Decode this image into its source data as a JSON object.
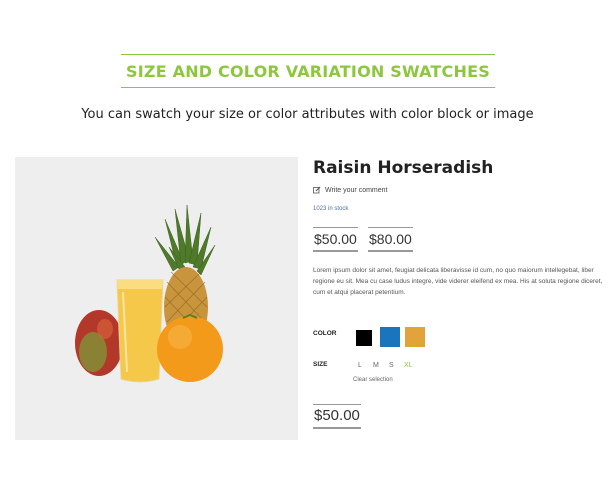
{
  "section": {
    "heading": "SIZE AND COLOR VARIATION SWATCHES",
    "subtitle": "You can swatch your size or color attributes with color block or image"
  },
  "product": {
    "image_alt": "fruit juice with pineapple, mango and orange",
    "title": "Raisin Horseradish",
    "review_link": "Write your comment",
    "stock": "1023 in stock",
    "prices": [
      "$50.00",
      "$80.00"
    ],
    "description": "Lorem ipsum dolor sit amet, feugiat delicata liberavisse id cum, no quo maiorum intellegebat, liber regione eu sit. Mea cu case ludus integre, vide viderer eleifend ex mea. His at soluta regione diceret, cum et atqui placerat petentium.",
    "selected_price": "$50.00"
  },
  "options": {
    "color_label": "COLOR",
    "colors": [
      "#000000",
      "#1b75bc",
      "#e2a33b"
    ],
    "size_label": "SIZE",
    "sizes": [
      "L",
      "M",
      "S",
      "XL"
    ],
    "selected_size": "XL",
    "clear_label": "Clear selection"
  },
  "theme": {
    "accent": "#8dc63f",
    "stock_color": "#4b6fa8"
  }
}
